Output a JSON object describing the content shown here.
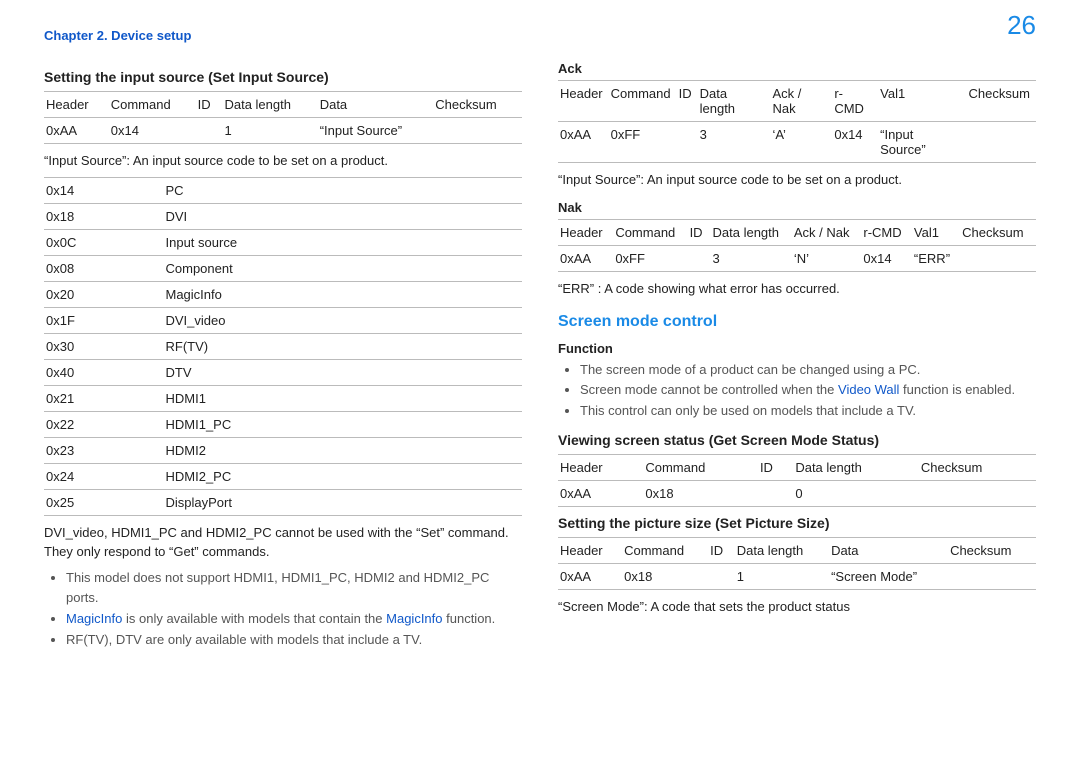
{
  "breadcrumb": "Chapter 2. Device setup",
  "page_number": "26",
  "left": {
    "title": "Setting the input source (Set Input Source)",
    "t1": [
      "Header",
      "Command",
      "ID",
      "Data length",
      "Data",
      "Checksum"
    ],
    "t1r": [
      "0xAA",
      "0x14",
      "",
      "1",
      "“Input Source”",
      ""
    ],
    "note1": "“Input Source”: An input source code to be set on a product.",
    "codes": [
      [
        "0x14",
        "PC"
      ],
      [
        "0x18",
        "DVI"
      ],
      [
        "0x0C",
        "Input source"
      ],
      [
        "0x08",
        "Component"
      ],
      [
        "0x20",
        "MagicInfo"
      ],
      [
        "0x1F",
        "DVI_video"
      ],
      [
        "0x30",
        "RF(TV)"
      ],
      [
        "0x40",
        "DTV"
      ],
      [
        "0x21",
        "HDMI1"
      ],
      [
        "0x22",
        "HDMI1_PC"
      ],
      [
        "0x23",
        "HDMI2"
      ],
      [
        "0x24",
        "HDMI2_PC"
      ],
      [
        "0x25",
        "DisplayPort"
      ]
    ],
    "note2": "DVI_video, HDMI1_PC and HDMI2_PC cannot be used with the “Set” command. They only respond to “Get” commands.",
    "b1": "This model does not support HDMI1, HDMI1_PC, HDMI2 and HDMI2_PC ports.",
    "b2a": "MagicInfo",
    "b2b": " is only available with models that contain the ",
    "b2c": "MagicInfo",
    "b2d": " function.",
    "b3": "RF(TV), DTV are only available with models that include a TV."
  },
  "right": {
    "ack": "Ack",
    "ack_h": [
      "Header",
      "Command",
      "ID",
      "Data length",
      "Ack / Nak",
      "r-CMD",
      "Val1",
      "Checksum"
    ],
    "ack_r": [
      "0xAA",
      "0xFF",
      "",
      "3",
      "‘A’",
      "0x14",
      "“Input Source”",
      ""
    ],
    "ack_note": "“Input Source”: An input source code to be set on a product.",
    "nak": "Nak",
    "nak_h": [
      "Header",
      "Command",
      "ID",
      "Data length",
      "Ack / Nak",
      "r-CMD",
      "Val1",
      "Checksum"
    ],
    "nak_r": [
      "0xAA",
      "0xFF",
      "",
      "3",
      "‘N’",
      "0x14",
      "“ERR”",
      ""
    ],
    "nak_note": "“ERR” : A code showing what error has occurred.",
    "smc": "Screen mode control",
    "func": "Function",
    "f1": "The screen mode of a product can be changed using a PC.",
    "f2a": "Screen mode cannot be controlled when the ",
    "f2b": "Video Wall",
    "f2c": " function is enabled.",
    "f3": "This control can only be used on models that include a TV.",
    "view_title": "Viewing screen status (Get Screen Mode Status)",
    "view_h": [
      "Header",
      "Command",
      "ID",
      "Data length",
      "Checksum"
    ],
    "view_r": [
      "0xAA",
      "0x18",
      "",
      "0",
      ""
    ],
    "set_title": "Setting the picture size (Set Picture Size)",
    "set_h": [
      "Header",
      "Command",
      "ID",
      "Data length",
      "Data",
      "Checksum"
    ],
    "set_r": [
      "0xAA",
      "0x18",
      "",
      "1",
      "“Screen Mode”",
      ""
    ],
    "set_note": "“Screen Mode”: A code that sets the product status"
  }
}
